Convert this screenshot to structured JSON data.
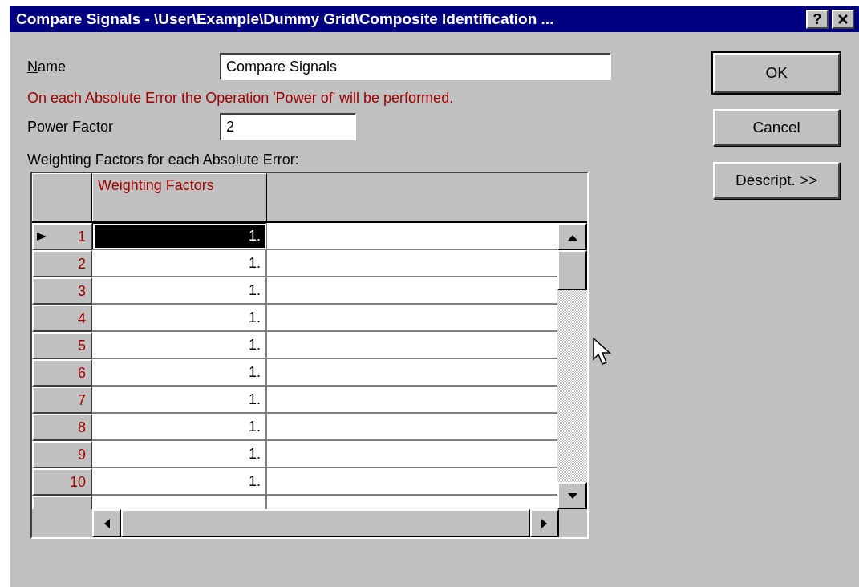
{
  "window": {
    "title": "Compare Signals - \\User\\Example\\Dummy Grid\\Composite Identification ...",
    "help_button": "?"
  },
  "name_field": {
    "label": "Name",
    "value": "Compare Signals"
  },
  "notice": "On each Absolute Error the Operation 'Power of' will be performed.",
  "power_field": {
    "label": "Power Factor",
    "value": "2"
  },
  "grid_caption": "Weighting Factors for each Absolute Error:",
  "table": {
    "columns": [
      "Weighting Factors"
    ],
    "rows": [
      {
        "number": "1",
        "value": "1.",
        "selected": true
      },
      {
        "number": "2",
        "value": "1.",
        "selected": false
      },
      {
        "number": "3",
        "value": "1.",
        "selected": false
      },
      {
        "number": "4",
        "value": "1.",
        "selected": false
      },
      {
        "number": "5",
        "value": "1.",
        "selected": false
      },
      {
        "number": "6",
        "value": "1.",
        "selected": false
      },
      {
        "number": "7",
        "value": "1.",
        "selected": false
      },
      {
        "number": "8",
        "value": "1.",
        "selected": false
      },
      {
        "number": "9",
        "value": "1.",
        "selected": false
      },
      {
        "number": "10",
        "value": "1.",
        "selected": false
      }
    ]
  },
  "buttons": [
    {
      "label": "OK",
      "default": true
    },
    {
      "label": "Cancel",
      "default": false
    },
    {
      "label": "Descript. >>",
      "default": false
    }
  ]
}
